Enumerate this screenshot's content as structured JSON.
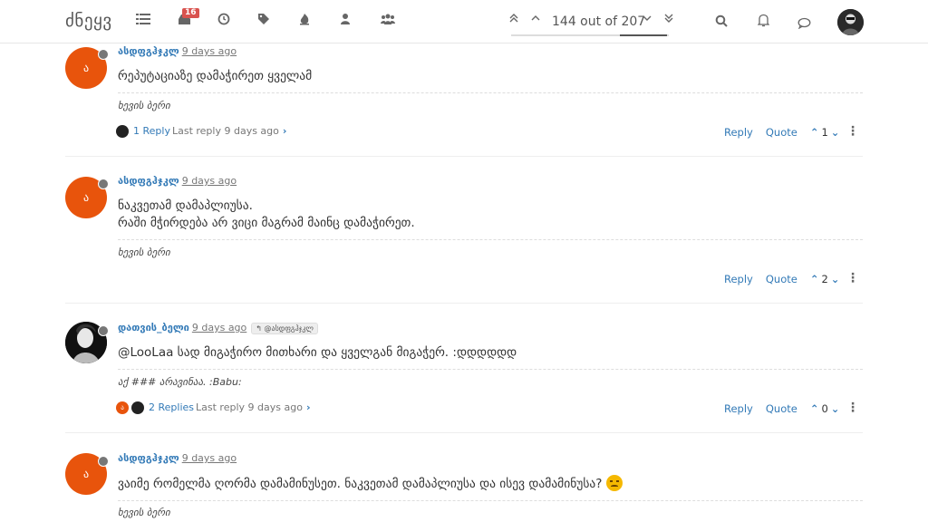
{
  "header": {
    "brand": "ძნეყვ",
    "notification_count": "16",
    "pager_text": "144 out of 207"
  },
  "posts": [
    {
      "author": "ასდფგჰჯკლ",
      "time": "9 days ago",
      "avatar_glyph": "ა",
      "content": [
        "რეპუტაციაზე დამაჭირეთ ყველამ"
      ],
      "signature": "ხევის ბერი",
      "replies_count": "1 Reply",
      "last_reply": "Last reply 9 days ago",
      "votes": "1"
    },
    {
      "author": "ასდფგჰჯკლ",
      "time": "9 days ago",
      "avatar_glyph": "ა",
      "content": [
        "ნაკვეთამ დამაპლიუსა.",
        "რაში მჭირდება არ ვიცი მაგრამ მაინც დამაჭირეთ."
      ],
      "signature": "ხევის ბერი",
      "votes": "2"
    },
    {
      "author": "დათვის_ბელი",
      "time": "9 days ago",
      "reply_to": "@ასდფგჰჯკლ",
      "content": [
        "@LooLaa სად მიგაჭირო მითხარი და ყველგან მიგაჭერ. :დდდდდდ"
      ],
      "signature": "აქ ### არავინაა. :Babu:",
      "replies_count": "2 Replies",
      "last_reply": "Last reply 9 days ago",
      "votes": "0"
    },
    {
      "author": "ასდფგჰჯკლ",
      "time": "9 days ago",
      "avatar_glyph": "ა",
      "content": [
        "ვაიმე რომელმა ღორმა დამამინუსეთ. ნაკვეთამ დამაპლიუსა და ისევ დამამინუსა?"
      ],
      "signature": "ხევის ბერი"
    }
  ],
  "labels": {
    "reply": "Reply",
    "quote": "Quote"
  },
  "icons": {
    "emoji": "frowning-face-emoji"
  }
}
